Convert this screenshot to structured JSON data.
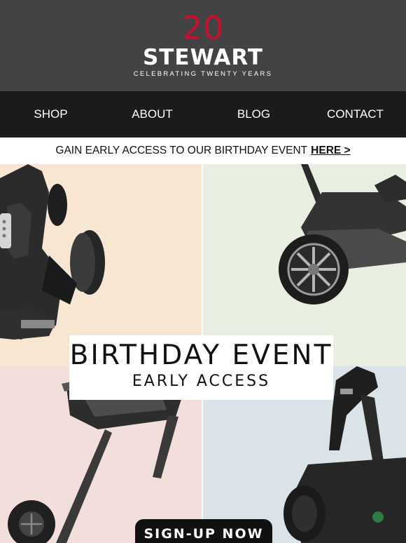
{
  "brand": {
    "logo_number": "20",
    "logo_word": "STEWART",
    "tagline": "CELEBRATING TWENTY YEARS",
    "accent_color": "#c8102e"
  },
  "nav": {
    "items": [
      {
        "label": "SHOP"
      },
      {
        "label": "ABOUT"
      },
      {
        "label": "BLOG"
      },
      {
        "label": "CONTACT"
      }
    ]
  },
  "promo": {
    "text": "GAIN EARLY ACCESS TO OUR BIRTHDAY EVENT",
    "link_label": "HERE >"
  },
  "hero": {
    "title": "BIRTHDAY EVENT",
    "subtitle": "EARLY ACCESS",
    "cta_label": "SIGN-UP NOW",
    "tile_colors": [
      "#f7e6d2",
      "#e8efe0",
      "#f2dfdc",
      "#d9e3e8"
    ],
    "tile_icons": [
      "golf-trolley-icon",
      "golf-trolley-icon",
      "golf-trolley-icon",
      "golf-trolley-icon"
    ]
  }
}
